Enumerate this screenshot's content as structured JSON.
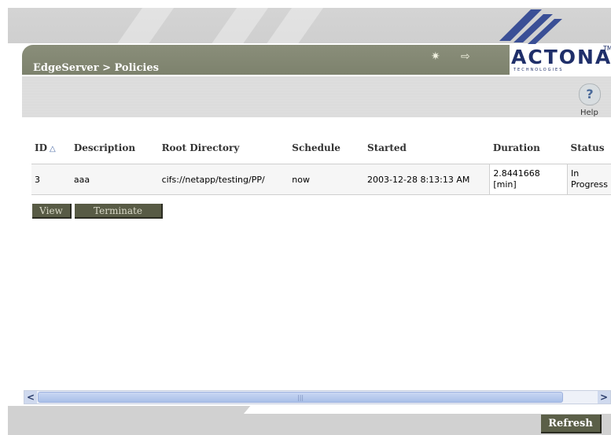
{
  "header": {
    "breadcrumb": "EdgeServer > Policies",
    "logo_text": "ACTONA",
    "logo_subtext": "TECHNOLOGIES",
    "logo_tm": "TM",
    "icons": [
      "wand-icon",
      "logout-icon"
    ]
  },
  "toolbar": {
    "help_label": "Help",
    "help_glyph": "?"
  },
  "table": {
    "columns": [
      "ID",
      "Description",
      "Root Directory",
      "Schedule",
      "Started",
      "Duration",
      "Status"
    ],
    "sort_indicator": "△",
    "rows": [
      {
        "id": "3",
        "description": "aaa",
        "root_directory": "cifs://netapp/testing/PP/",
        "schedule": "now",
        "started": "2003-12-28 8:13:13 AM",
        "duration_line1": "2.8441668",
        "duration_line2": "[min]",
        "status_line1": "In",
        "status_line2": "Progress"
      }
    ]
  },
  "actions": {
    "view_label": "View",
    "terminate_label": "Terminate"
  },
  "scrollbar": {
    "left_arrow": "<",
    "right_arrow": ">",
    "grip": "|||"
  },
  "footer": {
    "refresh_label": "Refresh"
  },
  "colors": {
    "brand_navy": "#1f2f6a",
    "olive_dark": "#585b45",
    "olive_bar": "#8a8e7a"
  }
}
